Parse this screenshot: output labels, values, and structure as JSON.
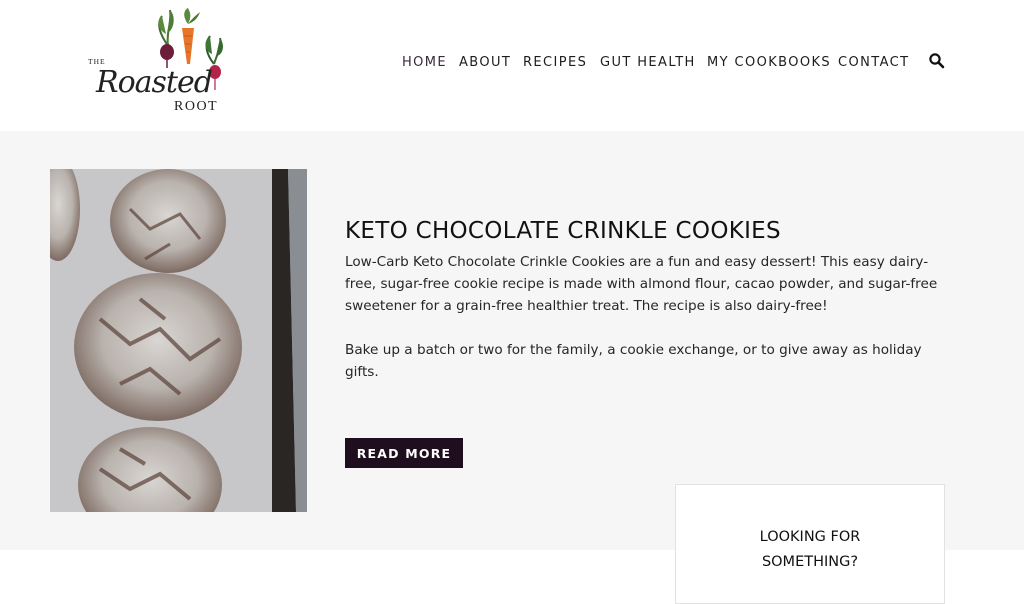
{
  "site": {
    "logo": {
      "prefix": "THE",
      "script": "Roasted",
      "suffix": "ROOT"
    }
  },
  "nav": {
    "items": [
      {
        "label": "HOME",
        "active": true
      },
      {
        "label": "ABOUT",
        "active": false
      },
      {
        "label": "RECIPES",
        "active": false
      },
      {
        "label": "GUT HEALTH",
        "active": false
      },
      {
        "label": "MY COOKBOOKS",
        "active": false
      },
      {
        "label": "CONTACT",
        "active": false
      }
    ],
    "search_icon": "search-icon"
  },
  "featured": {
    "image_alt": "Keto Chocolate Crinkle Cookies",
    "title": "KETO CHOCOLATE CRINKLE COOKIES",
    "paragraphs": [
      "Low-Carb Keto Chocolate Crinkle Cookies are a fun and easy dessert! This easy dairy-free, sugar-free cookie recipe is made with almond flour, cacao powder, and sugar-free sweetener for a grain-free healthier treat. The recipe is also dairy-free!",
      "Bake up a batch or two for the family, a cookie exchange, or to give away as holiday gifts."
    ],
    "read_more_label": "READ MORE"
  },
  "sidebar": {
    "search_box": {
      "title_line1": "LOOKING FOR",
      "title_line2": "SOMETHING?"
    }
  },
  "colors": {
    "read_more_bg": "#1f0f1e",
    "active_nav": "#3b2a3a",
    "section_bg": "#f6f6f6"
  }
}
